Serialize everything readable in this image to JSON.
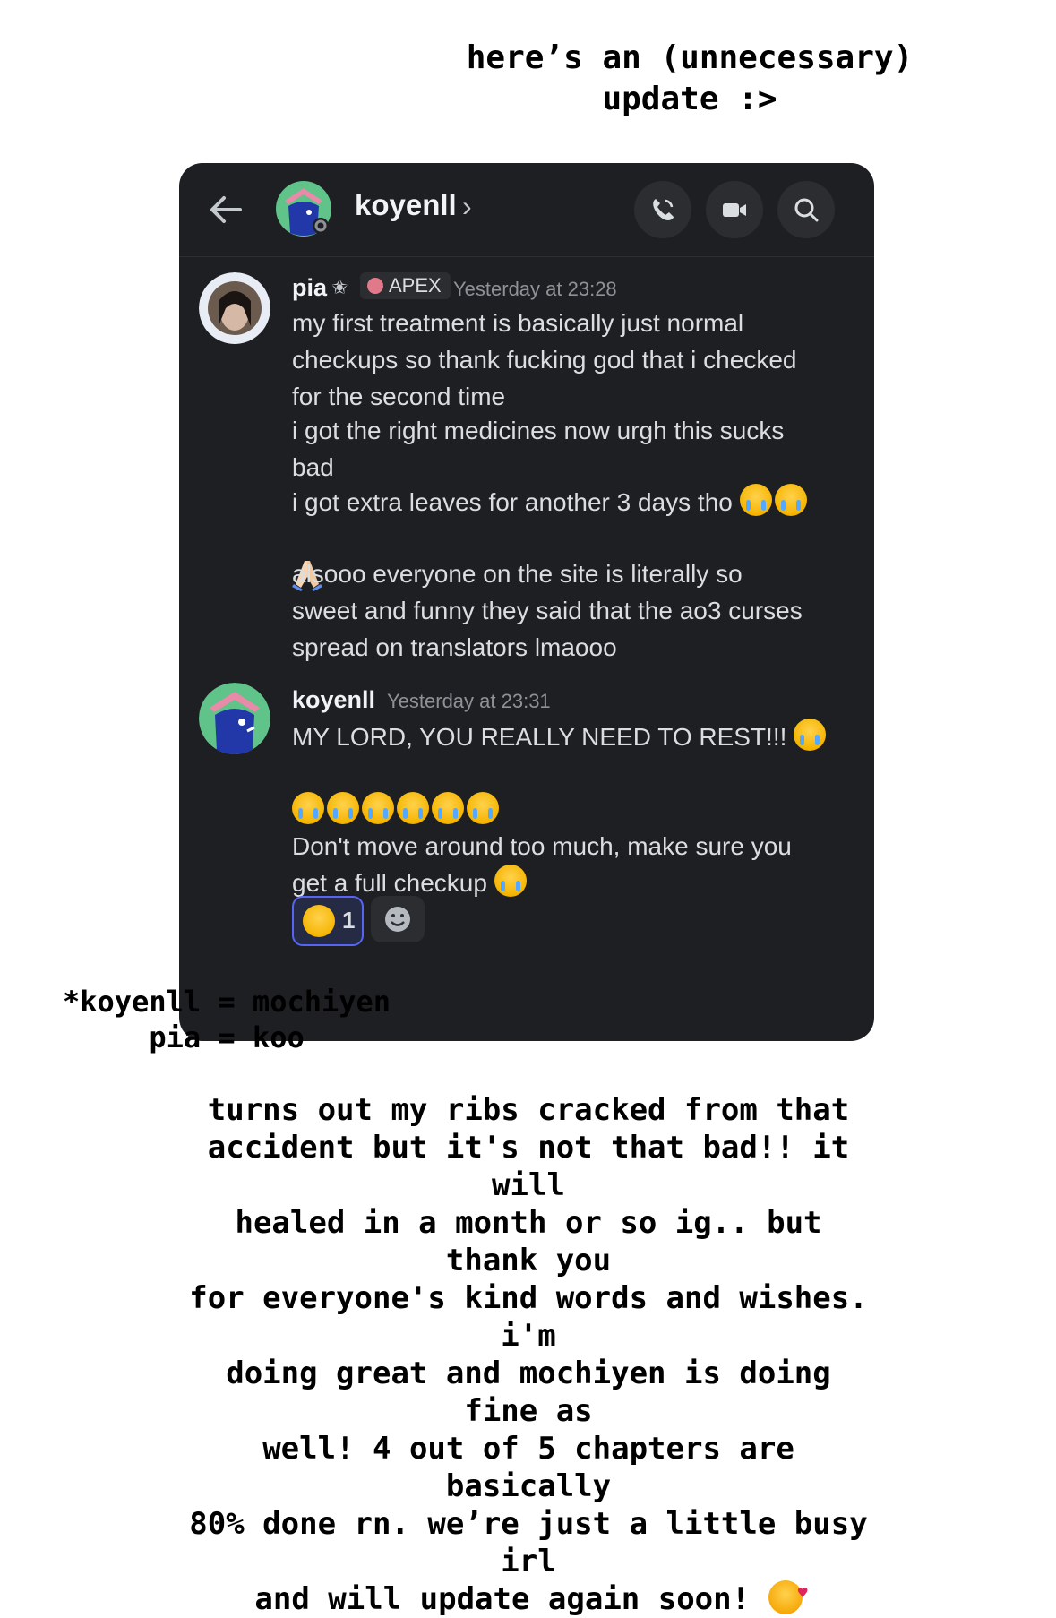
{
  "top_note": "here’s an (unnecessary)\nupdate :>",
  "header": {
    "contact_name": "koyenll",
    "chevron": "›"
  },
  "messages": [
    {
      "author": "pia",
      "tag": "APEX",
      "timestamp": "Yesterday at 23:28",
      "lines": [
        "my first treatment is basically just normal\ncheckups so thank fucking god that i checked\nfor the second time",
        "i got the right medicines now urgh this sucks\nbad",
        "i got extra leaves for another 3 days tho",
        "alsooo everyone on the site is literally so\nsweet and funny they said that the ao3 curses\nspread on translators lmaooo"
      ]
    },
    {
      "author": "koyenll",
      "timestamp": "Yesterday at 23:31",
      "lines": [
        "MY LORD, YOU REALLY NEED TO REST!!!",
        "Don't move around too much, make sure you\nget a full checkup"
      ],
      "reaction": {
        "emoji": "laughing-tears",
        "count": "1"
      }
    }
  ],
  "legend": "*koyenll = mochiyen\n     pia = koo",
  "bottom_note": "turns out my ribs cracked from that\naccident but it's not that bad!! it will\nhealed in a month or so ig.. but thank you\nfor everyone's kind words and wishes. i'm\ndoing great and mochiyen is doing fine as\nwell! 4 out of 5 chapters are basically\n80% done rn. we’re just a little busy irl\nand will update again soon!",
  "icons": {
    "back": "arrow-left-icon",
    "call": "phone-icon",
    "video": "video-camera-icon",
    "search": "search-icon",
    "add_reaction": "smile-icon"
  },
  "colors": {
    "panel_bg": "#1e1f23",
    "accent": "#5865f2"
  }
}
